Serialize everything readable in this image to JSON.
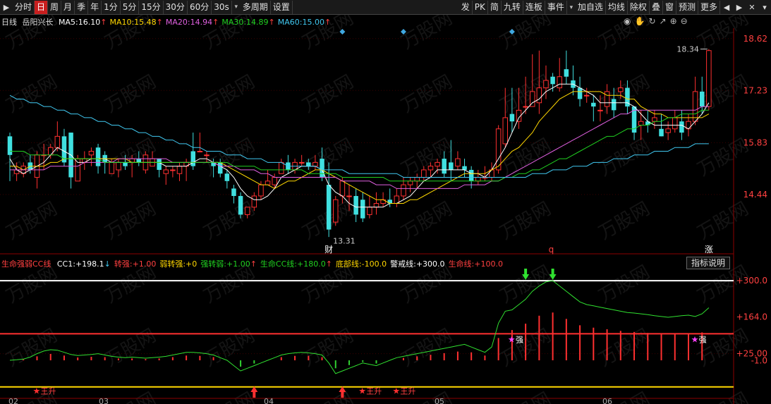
{
  "toolbar": {
    "left_items": [
      "分时",
      "日",
      "周",
      "月",
      "季",
      "年",
      "1分",
      "5分",
      "15分",
      "30分",
      "60分",
      "30s",
      "多周期",
      "设置"
    ],
    "active": "日",
    "right_items": [
      "发",
      "PK",
      "简",
      "九转",
      "连板",
      "事件",
      "加自选",
      "均线",
      "除权",
      "叠",
      "窗",
      "预测",
      "更多"
    ]
  },
  "stock": {
    "period": "日线",
    "name": "岳阳兴长"
  },
  "ma_legend": [
    {
      "label": "MA5:",
      "value": "16.10",
      "arrow": "↑",
      "color": "#ffffff"
    },
    {
      "label": "MA10:",
      "value": "15.48",
      "arrow": "↑",
      "color": "#ffd700"
    },
    {
      "label": "MA20:",
      "value": "14.94",
      "arrow": "↑",
      "color": "#e060e0"
    },
    {
      "label": "MA30:",
      "value": "14.89",
      "arrow": "↑",
      "color": "#20d020"
    },
    {
      "label": "MA60:",
      "value": "15.00",
      "arrow": "↑",
      "color": "#40c8f0"
    }
  ],
  "indicator_legend": {
    "name": "生命强弱CC线",
    "items": [
      {
        "label": "CC1:",
        "value": "+198.1",
        "arrow": "↓",
        "color": "#ffffff"
      },
      {
        "label": "转强:",
        "value": "+1.00",
        "arrow": "",
        "color": "#ff4040"
      },
      {
        "label": "弱转强:",
        "value": "+0",
        "arrow": "",
        "color": "#ffd700"
      },
      {
        "label": "强转弱:",
        "value": "+1.00",
        "arrow": "↑",
        "color": "#20d020"
      },
      {
        "label": "生命CC线:",
        "value": "+180.0",
        "arrow": "↑",
        "color": "#20d020"
      },
      {
        "label": "底部线:",
        "value": "-100.0",
        "arrow": "",
        "color": "#ffd700"
      },
      {
        "label": "警戒线:",
        "value": "+300.0",
        "arrow": "",
        "color": "#ffffff"
      },
      {
        "label": "生命线:",
        "value": "+100.0",
        "arrow": "",
        "color": "#ff4040"
      }
    ],
    "button": "指标说明"
  },
  "chart_data": {
    "type": "candlestick",
    "price_axis": {
      "ticks": [
        "18.62",
        "17.23",
        "15.83",
        "14.44"
      ],
      "range": [
        13.0,
        18.9
      ]
    },
    "indicator_axis": {
      "ticks": [
        "+300.0",
        "+164.0",
        "+25.00",
        "-1.0"
      ],
      "range": [
        -130,
        340
      ]
    },
    "month_labels": [
      "02",
      "03",
      "04",
      "05",
      "06"
    ],
    "annotations": {
      "high": "18.34",
      "low": "13.31",
      "markers": [
        "财",
        "q",
        "涨"
      ],
      "signals": [
        "王升",
        "强"
      ]
    },
    "candles": [
      [
        16.0,
        15.5,
        16.1,
        14.8
      ],
      [
        15.0,
        15.1,
        15.3,
        14.8
      ],
      [
        15.0,
        15.2,
        15.3,
        14.9
      ],
      [
        15.3,
        15.1,
        15.5,
        15.0
      ],
      [
        14.9,
        15.5,
        15.6,
        14.6
      ],
      [
        15.5,
        15.5,
        15.8,
        15.1
      ],
      [
        15.5,
        15.7,
        15.8,
        15.4
      ],
      [
        15.7,
        16.0,
        16.4,
        15.6
      ],
      [
        16.0,
        15.3,
        16.2,
        15.2
      ],
      [
        16.1,
        14.9,
        16.1,
        14.6
      ],
      [
        14.8,
        15.4,
        15.5,
        14.8
      ],
      [
        15.3,
        15.4,
        15.6,
        15.1
      ],
      [
        15.5,
        15.6,
        15.7,
        15.2
      ],
      [
        15.7,
        15.2,
        15.8,
        15.0
      ],
      [
        15.5,
        15.3,
        15.6,
        15.0
      ],
      [
        15.0,
        15.3,
        15.4,
        15.0
      ],
      [
        15.1,
        15.3,
        15.4,
        14.9
      ],
      [
        15.3,
        15.2,
        15.5,
        15.1
      ],
      [
        15.3,
        15.4,
        15.5,
        14.9
      ],
      [
        15.4,
        15.3,
        15.6,
        15.2
      ],
      [
        15.1,
        15.5,
        15.6,
        15.0
      ],
      [
        15.2,
        15.4,
        15.6,
        15.2
      ],
      [
        15.4,
        15.1,
        15.4,
        14.9
      ],
      [
        15.0,
        15.1,
        15.2,
        14.7
      ],
      [
        15.1,
        15.1,
        15.2,
        14.9
      ],
      [
        15.0,
        15.2,
        15.3,
        14.8
      ],
      [
        15.2,
        15.3,
        15.4,
        14.8
      ],
      [
        15.6,
        15.2,
        16.1,
        15.1
      ],
      [
        15.6,
        15.6,
        16.1,
        15.6
      ],
      [
        15.5,
        15.5,
        15.6,
        15.3
      ],
      [
        15.3,
        15.2,
        15.4,
        14.9
      ],
      [
        15.3,
        15.0,
        15.4,
        14.9
      ],
      [
        15.0,
        14.8,
        15.1,
        14.6
      ],
      [
        14.6,
        14.4,
        14.7,
        14.2
      ],
      [
        14.4,
        13.9,
        14.5,
        13.8
      ],
      [
        13.9,
        14.1,
        14.1,
        13.8
      ],
      [
        14.1,
        14.4,
        14.5,
        14.0
      ],
      [
        14.4,
        14.7,
        14.8,
        14.3
      ],
      [
        14.7,
        14.8,
        15.1,
        14.7
      ],
      [
        14.7,
        14.9,
        15.0,
        14.6
      ],
      [
        15.0,
        15.3,
        15.4,
        15.0
      ],
      [
        15.3,
        15.1,
        15.5,
        15.0
      ],
      [
        15.1,
        15.3,
        15.4,
        15.0
      ],
      [
        15.3,
        15.3,
        15.5,
        15.2
      ],
      [
        15.3,
        15.2,
        15.4,
        15.1
      ],
      [
        15.2,
        15.3,
        15.5,
        15.1
      ],
      [
        15.4,
        14.9,
        15.7,
        14.8
      ],
      [
        14.7,
        13.5,
        15.3,
        13.3
      ],
      [
        13.7,
        14.3,
        14.4,
        13.6
      ],
      [
        14.4,
        14.8,
        14.9,
        14.2
      ],
      [
        14.4,
        14.4,
        14.7,
        14.0
      ],
      [
        14.4,
        13.9,
        14.6,
        13.7
      ],
      [
        14.3,
        13.8,
        14.5,
        13.7
      ],
      [
        13.9,
        14.1,
        14.4,
        13.8
      ],
      [
        14.1,
        14.2,
        14.5,
        13.9
      ],
      [
        14.2,
        14.3,
        14.5,
        14.1
      ],
      [
        14.3,
        14.2,
        14.6,
        14.1
      ],
      [
        14.2,
        14.4,
        14.6,
        14.1
      ],
      [
        14.4,
        14.7,
        14.9,
        14.3
      ],
      [
        14.7,
        14.8,
        14.9,
        14.5
      ],
      [
        14.8,
        14.9,
        15.0,
        14.6
      ],
      [
        14.9,
        15.1,
        15.2,
        14.8
      ],
      [
        15.1,
        15.2,
        15.3,
        14.9
      ],
      [
        15.2,
        15.3,
        15.4,
        15.0
      ],
      [
        15.4,
        15.0,
        15.6,
        14.9
      ],
      [
        15.3,
        15.1,
        15.9,
        14.8
      ],
      [
        15.2,
        15.4,
        15.6,
        15.1
      ],
      [
        15.2,
        15.1,
        15.4,
        14.9
      ],
      [
        15.1,
        14.8,
        15.2,
        14.6
      ],
      [
        14.8,
        14.9,
        15.1,
        14.7
      ],
      [
        14.9,
        14.9,
        15.2,
        14.8
      ],
      [
        14.9,
        15.1,
        15.3,
        14.8
      ],
      [
        15.1,
        16.2,
        16.3,
        15.0
      ],
      [
        15.8,
        16.5,
        17.3,
        15.7
      ],
      [
        16.6,
        16.4,
        17.3,
        16.1
      ],
      [
        16.4,
        16.7,
        17.3,
        16.2
      ],
      [
        16.8,
        16.8,
        17.6,
        16.6
      ],
      [
        16.8,
        17.2,
        18.2,
        16.8
      ],
      [
        16.9,
        17.3,
        18.3,
        16.6
      ],
      [
        17.3,
        17.5,
        17.9,
        17.0
      ],
      [
        17.6,
        17.4,
        17.7,
        17.2
      ],
      [
        17.3,
        17.6,
        18.1,
        17.2
      ],
      [
        17.8,
        17.6,
        18.3,
        17.4
      ],
      [
        17.5,
        17.3,
        17.9,
        17.1
      ],
      [
        17.3,
        17.0,
        17.6,
        16.8
      ],
      [
        17.1,
        17.1,
        17.3,
        16.9
      ],
      [
        16.9,
        16.8,
        17.1,
        16.4
      ],
      [
        16.7,
        16.7,
        17.1,
        16.4
      ],
      [
        16.8,
        17.2,
        17.4,
        16.6
      ],
      [
        17.0,
        16.7,
        17.3,
        16.5
      ],
      [
        17.2,
        17.3,
        17.5,
        17.0
      ],
      [
        17.3,
        16.8,
        17.5,
        16.6
      ],
      [
        16.8,
        16.1,
        16.8,
        15.9
      ],
      [
        16.3,
        16.4,
        16.7,
        15.9
      ],
      [
        16.4,
        16.3,
        16.7,
        16.1
      ],
      [
        16.4,
        16.5,
        16.7,
        16.2
      ],
      [
        16.2,
        16.0,
        16.6,
        16.0
      ],
      [
        16.1,
        16.2,
        16.4,
        15.9
      ],
      [
        16.2,
        16.5,
        16.7,
        16.1
      ],
      [
        16.4,
        16.1,
        16.7,
        15.9
      ],
      [
        16.2,
        16.4,
        16.6,
        16.0
      ],
      [
        16.4,
        17.2,
        17.6,
        16.3
      ],
      [
        17.2,
        16.8,
        17.6,
        16.6
      ],
      [
        16.8,
        18.3,
        18.34,
        16.7
      ]
    ],
    "ma": {
      "MA5": [
        15.4,
        15.1,
        15.0,
        15.1,
        15.2,
        15.3,
        15.5,
        15.7,
        15.6,
        15.5,
        15.3,
        15.3,
        15.4,
        15.4,
        15.4,
        15.3,
        15.3,
        15.3,
        15.3,
        15.3,
        15.3,
        15.3,
        15.3,
        15.2,
        15.2,
        15.2,
        15.2,
        15.3,
        15.4,
        15.4,
        15.3,
        15.2,
        15.1,
        14.9,
        14.6,
        14.4,
        14.3,
        14.3,
        14.4,
        14.6,
        14.9,
        15.0,
        15.1,
        15.2,
        15.2,
        15.2,
        15.1,
        14.7,
        14.5,
        14.4,
        14.2,
        14.1,
        14.1,
        14.1,
        14.1,
        14.1,
        14.2,
        14.2,
        14.3,
        14.4,
        14.6,
        14.8,
        14.9,
        15.1,
        15.1,
        15.1,
        15.1,
        15.1,
        15.0,
        15.0,
        14.9,
        15.1,
        15.4,
        15.7,
        16.1,
        16.5,
        16.7,
        16.9,
        17.0,
        17.2,
        17.3,
        17.4,
        17.4,
        17.4,
        17.3,
        17.2,
        17.1,
        16.9,
        16.9,
        16.9,
        16.9,
        16.9,
        16.8,
        16.6,
        16.4,
        16.3,
        16.3,
        16.3,
        16.3,
        16.3,
        16.2,
        16.4,
        16.6,
        16.9
      ],
      "MA10": [
        15.2,
        15.2,
        15.1,
        15.2,
        15.2,
        15.2,
        15.3,
        15.3,
        15.4,
        15.4,
        15.4,
        15.4,
        15.4,
        15.4,
        15.4,
        15.4,
        15.4,
        15.4,
        15.3,
        15.3,
        15.3,
        15.3,
        15.3,
        15.3,
        15.3,
        15.3,
        15.3,
        15.3,
        15.3,
        15.3,
        15.3,
        15.3,
        15.2,
        15.1,
        15.0,
        14.9,
        14.8,
        14.7,
        14.7,
        14.6,
        14.7,
        14.8,
        14.8,
        14.9,
        15.0,
        15.1,
        15.1,
        15.0,
        14.9,
        14.8,
        14.7,
        14.6,
        14.5,
        14.4,
        14.3,
        14.3,
        14.2,
        14.2,
        14.2,
        14.3,
        14.3,
        14.4,
        14.5,
        14.6,
        14.7,
        14.8,
        14.9,
        15.0,
        15.0,
        15.0,
        15.0,
        15.1,
        15.2,
        15.4,
        15.6,
        15.7,
        15.9,
        16.1,
        16.4,
        16.6,
        16.8,
        17.0,
        17.1,
        17.2,
        17.2,
        17.2,
        17.2,
        17.2,
        17.1,
        17.1,
        17.1,
        17.0,
        17.0,
        16.8,
        16.7,
        16.6,
        16.6,
        16.5,
        16.5,
        16.5,
        16.5,
        16.5,
        16.5,
        16.6
      ],
      "MA20": [
        15.1,
        15.1,
        15.1,
        15.1,
        15.1,
        15.1,
        15.2,
        15.2,
        15.2,
        15.2,
        15.2,
        15.3,
        15.3,
        15.3,
        15.3,
        15.3,
        15.4,
        15.4,
        15.4,
        15.4,
        15.4,
        15.4,
        15.4,
        15.4,
        15.3,
        15.3,
        15.3,
        15.3,
        15.3,
        15.3,
        15.3,
        15.2,
        15.2,
        15.2,
        15.1,
        15.1,
        15.1,
        15.0,
        15.0,
        14.9,
        14.9,
        14.9,
        14.9,
        14.9,
        14.9,
        14.9,
        14.9,
        14.9,
        14.9,
        14.8,
        14.8,
        14.8,
        14.8,
        14.8,
        14.7,
        14.7,
        14.7,
        14.6,
        14.6,
        14.6,
        14.6,
        14.6,
        14.6,
        14.6,
        14.6,
        14.6,
        14.6,
        14.7,
        14.7,
        14.7,
        14.7,
        14.8,
        14.8,
        14.9,
        15.0,
        15.1,
        15.2,
        15.3,
        15.4,
        15.5,
        15.6,
        15.7,
        15.8,
        15.9,
        16.0,
        16.1,
        16.2,
        16.3,
        16.4,
        16.5,
        16.6,
        16.6,
        16.7,
        16.7,
        16.7,
        16.7,
        16.7,
        16.7,
        16.7,
        16.7,
        16.7,
        16.7,
        16.8,
        16.8
      ],
      "MA30": [
        15.6,
        15.6,
        15.6,
        15.5,
        15.5,
        15.5,
        15.5,
        15.5,
        15.4,
        15.4,
        15.4,
        15.4,
        15.4,
        15.4,
        15.3,
        15.3,
        15.3,
        15.3,
        15.3,
        15.3,
        15.3,
        15.3,
        15.3,
        15.3,
        15.3,
        15.3,
        15.3,
        15.3,
        15.3,
        15.3,
        15.3,
        15.3,
        15.3,
        15.2,
        15.2,
        15.2,
        15.2,
        15.1,
        15.1,
        15.1,
        15.1,
        15.1,
        15.1,
        15.1,
        15.0,
        15.0,
        15.0,
        15.0,
        15.0,
        14.9,
        14.9,
        14.9,
        14.9,
        14.9,
        14.9,
        14.9,
        14.8,
        14.8,
        14.8,
        14.8,
        14.8,
        14.8,
        14.8,
        14.8,
        14.8,
        14.8,
        14.8,
        14.8,
        14.8,
        14.8,
        14.8,
        14.8,
        14.8,
        14.9,
        14.9,
        15.0,
        15.0,
        15.1,
        15.1,
        15.2,
        15.3,
        15.4,
        15.4,
        15.5,
        15.6,
        15.7,
        15.8,
        15.9,
        16.0,
        16.0,
        16.1,
        16.2,
        16.2,
        16.3,
        16.3,
        16.4,
        16.4,
        16.5,
        16.5,
        16.6,
        16.6,
        16.6,
        16.7,
        16.7
      ],
      "MA60": [
        17.1,
        17.0,
        17.0,
        16.9,
        16.9,
        16.8,
        16.8,
        16.7,
        16.7,
        16.6,
        16.6,
        16.5,
        16.5,
        16.4,
        16.4,
        16.3,
        16.3,
        16.2,
        16.2,
        16.1,
        16.1,
        16.0,
        16.0,
        15.9,
        15.9,
        15.8,
        15.8,
        15.7,
        15.7,
        15.6,
        15.6,
        15.6,
        15.5,
        15.5,
        15.5,
        15.4,
        15.4,
        15.4,
        15.3,
        15.3,
        15.3,
        15.2,
        15.2,
        15.2,
        15.2,
        15.2,
        15.1,
        15.1,
        15.1,
        15.1,
        15.0,
        15.0,
        15.0,
        15.0,
        15.0,
        15.0,
        15.0,
        15.0,
        14.9,
        14.9,
        14.9,
        14.9,
        14.9,
        14.9,
        14.9,
        14.9,
        14.9,
        14.9,
        14.9,
        14.9,
        14.9,
        14.9,
        14.9,
        14.9,
        14.9,
        14.9,
        14.9,
        15.0,
        15.0,
        15.0,
        15.1,
        15.1,
        15.1,
        15.2,
        15.2,
        15.2,
        15.3,
        15.3,
        15.3,
        15.4,
        15.4,
        15.4,
        15.5,
        15.5,
        15.5,
        15.6,
        15.6,
        15.6,
        15.7,
        15.7,
        15.7,
        15.8,
        15.8,
        15.8
      ]
    },
    "cc": [
      0,
      2,
      5,
      12,
      25,
      35,
      40,
      38,
      30,
      22,
      18,
      20,
      22,
      25,
      20,
      15,
      12,
      10,
      12,
      10,
      8,
      10,
      12,
      15,
      20,
      25,
      30,
      30,
      28,
      25,
      20,
      10,
      0,
      -20,
      -40,
      -30,
      -20,
      -10,
      0,
      10,
      20,
      25,
      28,
      30,
      28,
      25,
      20,
      -10,
      -50,
      -40,
      -30,
      -20,
      -10,
      -15,
      -20,
      -10,
      0,
      10,
      15,
      20,
      25,
      30,
      35,
      40,
      45,
      50,
      55,
      60,
      50,
      40,
      30,
      50,
      140,
      185,
      190,
      210,
      230,
      260,
      280,
      295,
      300,
      280,
      260,
      240,
      220,
      210,
      205,
      200,
      195,
      190,
      185,
      180,
      178,
      175,
      172,
      168,
      165,
      162,
      165,
      168,
      170,
      165,
      175,
      198
    ]
  }
}
